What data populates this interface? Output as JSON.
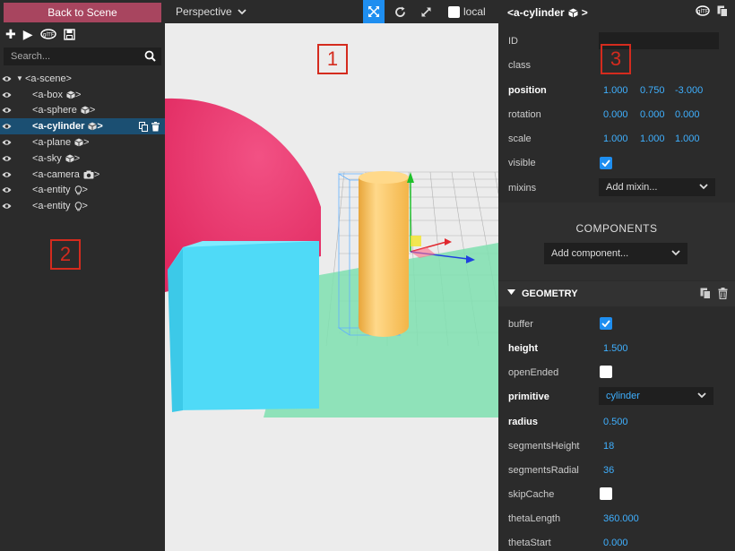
{
  "left_panel": {
    "back_button": "Back to Scene",
    "search_placeholder": "Search...",
    "tree": [
      {
        "label": "<a-scene>",
        "kind": "scene",
        "selected": false
      },
      {
        "label": "<a-box",
        "kind": "cube-icon",
        "selected": false
      },
      {
        "label": "<a-sphere",
        "kind": "cube-icon",
        "selected": false
      },
      {
        "label": "<a-cylinder",
        "kind": "cube-icon",
        "selected": true
      },
      {
        "label": "<a-plane",
        "kind": "cube-icon",
        "selected": false
      },
      {
        "label": "<a-sky",
        "kind": "cube-icon",
        "selected": false
      },
      {
        "label": "<a-camera",
        "kind": "camera-icon",
        "selected": false
      },
      {
        "label": "<a-entity",
        "kind": "bulb-icon",
        "selected": false
      },
      {
        "label": "<a-entity",
        "kind": "bulb-icon",
        "selected": false
      }
    ],
    "close_bracket": ">"
  },
  "viewport": {
    "camera_mode": "Perspective",
    "local_label": "local"
  },
  "inspector": {
    "entity_title": "<a-cylinder",
    "entity_title_suffix": ">",
    "id_label": "ID",
    "class_label": "class",
    "position_label": "position",
    "position": [
      "1.000",
      "0.750",
      "-3.000"
    ],
    "rotation_label": "rotation",
    "rotation": [
      "0.000",
      "0.000",
      "0.000"
    ],
    "scale_label": "scale",
    "scale": [
      "1.000",
      "1.000",
      "1.000"
    ],
    "visible_label": "visible",
    "mixins_label": "mixins",
    "mixins_placeholder": "Add mixin...",
    "components_title": "COMPONENTS",
    "add_component": "Add component...",
    "geometry_title": "GEOMETRY",
    "geometry": {
      "buffer_label": "buffer",
      "height_label": "height",
      "height": "1.500",
      "openEnded_label": "openEnded",
      "primitive_label": "primitive",
      "primitive": "cylinder",
      "radius_label": "radius",
      "radius": "0.500",
      "segmentsHeight_label": "segmentsHeight",
      "segmentsHeight": "18",
      "segmentsRadial_label": "segmentsRadial",
      "segmentsRadial": "36",
      "skipCache_label": "skipCache",
      "thetaLength_label": "thetaLength",
      "thetaLength": "360.000",
      "thetaStart_label": "thetaStart",
      "thetaStart": "0.000"
    }
  },
  "callouts": [
    "1",
    "2",
    "3"
  ],
  "colors": {
    "accent_blue": "#3fb0ff",
    "selected_row": "#1b4f72",
    "back_button": "#a8455f",
    "callout_red": "#d42b1e",
    "sphere": "#e8336a",
    "box": "#4fdaf7",
    "cylinder": "#ffc04d",
    "plane": "#7fe0b0"
  }
}
